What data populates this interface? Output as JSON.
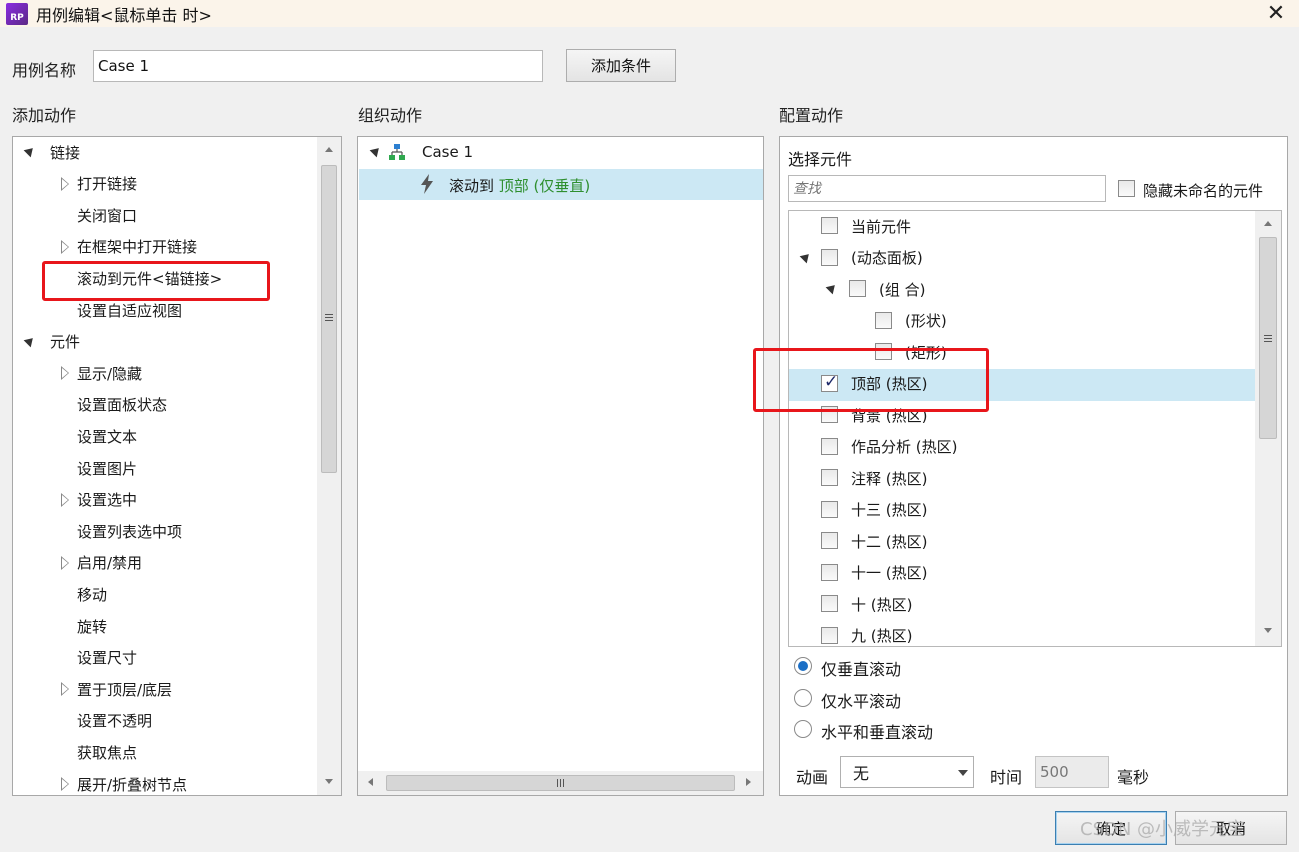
{
  "window": {
    "title": "用例编辑<鼠标单击 时>",
    "icon": "axure-rp-icon"
  },
  "case_name": {
    "label": "用例名称",
    "value": "Case 1",
    "add_condition": "添加条件"
  },
  "add_actions": {
    "header": "添加动作",
    "tree": [
      {
        "label": "链接",
        "expanded": true,
        "level": 0
      },
      {
        "label": "打开链接",
        "collapsed": true,
        "level": 1
      },
      {
        "label": "关闭窗口",
        "level": 1
      },
      {
        "label": "在框架中打开链接",
        "collapsed": true,
        "level": 1
      },
      {
        "label": "滚动到元件<锚链接>",
        "level": 1,
        "highlighted": true
      },
      {
        "label": "设置自适应视图",
        "level": 1
      },
      {
        "label": "元件",
        "expanded": true,
        "level": 0
      },
      {
        "label": "显示/隐藏",
        "collapsed": true,
        "level": 1
      },
      {
        "label": "设置面板状态",
        "level": 1
      },
      {
        "label": "设置文本",
        "level": 1
      },
      {
        "label": "设置图片",
        "level": 1
      },
      {
        "label": "设置选中",
        "collapsed": true,
        "level": 1
      },
      {
        "label": "设置列表选中项",
        "level": 1
      },
      {
        "label": "启用/禁用",
        "collapsed": true,
        "level": 1
      },
      {
        "label": "移动",
        "level": 1
      },
      {
        "label": "旋转",
        "level": 1
      },
      {
        "label": "设置尺寸",
        "level": 1
      },
      {
        "label": "置于顶层/底层",
        "collapsed": true,
        "level": 1
      },
      {
        "label": "设置不透明",
        "level": 1
      },
      {
        "label": "获取焦点",
        "level": 1
      },
      {
        "label": "展开/折叠树节点",
        "collapsed": true,
        "level": 1
      }
    ]
  },
  "organize_actions": {
    "header": "组织动作",
    "case_label": "Case 1",
    "action_prefix": "滚动到 ",
    "action_target": "顶部 (仅垂直)"
  },
  "configure_actions": {
    "header": "配置动作",
    "select_widget": "选择元件",
    "search_placeholder": "查找",
    "hide_unnamed": "隐藏未命名的元件",
    "widgets": [
      {
        "label": "当前元件",
        "checked": false
      },
      {
        "label": "(动态面板)",
        "checked": false
      },
      {
        "label": "(组 合)",
        "checked": false
      },
      {
        "label": "(形状)",
        "checked": false
      },
      {
        "label": "(矩形)",
        "checked": false
      },
      {
        "label": "顶部 (热区)",
        "checked": true
      },
      {
        "label": "背景 (热区)",
        "checked": false
      },
      {
        "label": "作品分析 (热区)",
        "checked": false
      },
      {
        "label": "注释 (热区)",
        "checked": false
      },
      {
        "label": "十三 (热区)",
        "checked": false
      },
      {
        "label": "十二 (热区)",
        "checked": false
      },
      {
        "label": "十一 (热区)",
        "checked": false
      },
      {
        "label": "十 (热区)",
        "checked": false
      },
      {
        "label": "九 (热区)",
        "checked": false
      }
    ],
    "scroll_options": [
      {
        "label": "仅垂直滚动",
        "selected": true
      },
      {
        "label": "仅水平滚动",
        "selected": false
      },
      {
        "label": "水平和垂直滚动",
        "selected": false
      }
    ],
    "animation_label": "动画",
    "animation_value": "无",
    "time_label": "时间",
    "time_value": "500",
    "ms_label": "毫秒"
  },
  "footer": {
    "ok": "确定",
    "cancel": "取消",
    "watermark": "CSDN @小威学元宝"
  },
  "colors": {
    "selection": "#cce8f4",
    "highlight_box": "#e8161b",
    "green_text": "#2f8f2f"
  }
}
